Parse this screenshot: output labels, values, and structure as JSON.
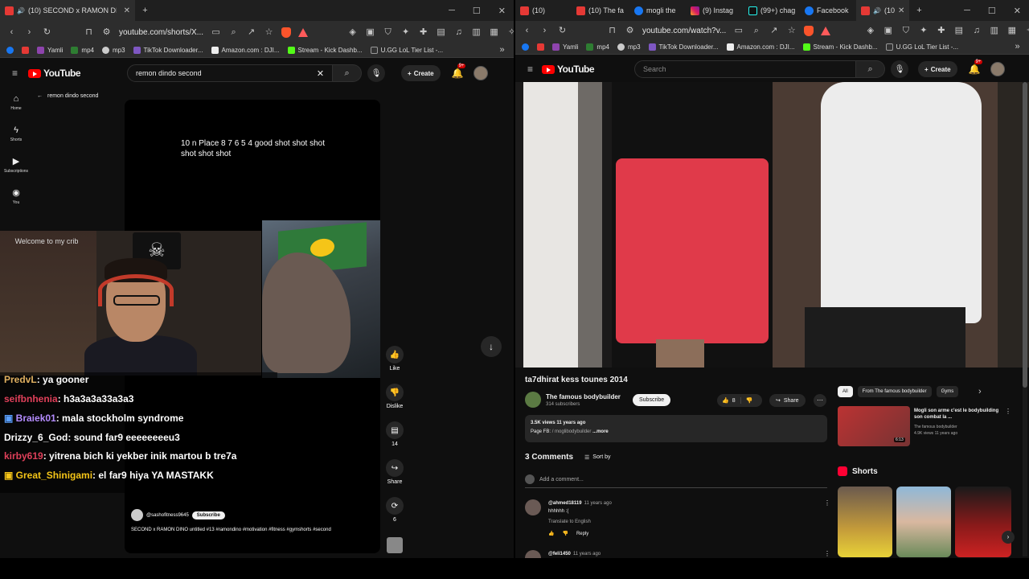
{
  "left": {
    "tab": {
      "title": "(10) SECOND x RAMON DINO"
    },
    "address": {
      "url": "youtube.com/shorts/X..."
    },
    "bookmarks": [
      "Yamli",
      "mp4",
      "mp3",
      "TikTok Downloader...",
      "Amazon.com : DJI...",
      "Stream - Kick Dashb...",
      "U.GG LoL Tier List -..."
    ],
    "header": {
      "search_value": "remon dindo second",
      "create_label": "Create",
      "bell_badge": "9+"
    },
    "nav": [
      {
        "label": "Home",
        "icon": "home-icon"
      },
      {
        "label": "Shorts",
        "icon": "shorts-icon"
      },
      {
        "label": "Subscriptions",
        "icon": "subscriptions-icon"
      },
      {
        "label": "You",
        "icon": "you-icon"
      }
    ],
    "back_label": "remon dindo second",
    "overlay_text": "10 n Place 8 7 6 5 4 good shot shot shot shot shot shot",
    "welcome_text": "Welcome to my crib",
    "chat": [
      {
        "user": "PredvL",
        "msg": ": ya gooner",
        "color": "#e0b060"
      },
      {
        "user": "seifbnhenia",
        "msg": ": h3a3a3a33a3a3",
        "color": "#e0405a"
      },
      {
        "user": "Braiek01",
        "msg": ": mala stockholm syndrome",
        "color": "#b48cff"
      },
      {
        "user": "Drizzy_6_God",
        "msg": ": sound far9 eeeeeeeeu3",
        "color": "#ffffff"
      },
      {
        "user": "kirby619",
        "msg": ": yitrena bich ki yekber inik martou b tre7a",
        "color": "#e0405a"
      },
      {
        "user": "Great_Shinigami",
        "msg": ": el far9 hiya YA MASTAKK",
        "color": "#f5c518"
      }
    ],
    "reel": {
      "channel": "@sashofitness9645",
      "subscribe": "Subscribe",
      "description": "SECOND x RAMON DINO untitled #13 #ramondino #motivation #fitness #gymshorts #second"
    },
    "actions": {
      "like": "Like",
      "dislike": "Dislike",
      "comments": "14",
      "share": "Share",
      "remix": "6"
    }
  },
  "right": {
    "tabs": [
      "(10)",
      "(10) The fa",
      "mogli the",
      "(9) Instag",
      "(99+) chag",
      "Facebook",
      "(10"
    ],
    "address": {
      "url": "youtube.com/watch?v..."
    },
    "bookmarks": [
      "Yamli",
      "mp4",
      "mp3",
      "TikTok Downloader...",
      "Amazon.com : DJI...",
      "Stream - Kick Dashb...",
      "U.GG LoL Tier List -..."
    ],
    "header": {
      "search_placeholder": "Search",
      "create_label": "Create",
      "bell_badge": "9+"
    },
    "video": {
      "title": "ta7dhirat kess tounes 2014",
      "channel": "The famous bodybuilder",
      "subscribers": "314 subscribers",
      "subscribe": "Subscribe",
      "likes": "8",
      "share": "Share",
      "views_line": "3.5K views  11 years ago",
      "desc_line": "Page FB:",
      "desc_link": "/ moglibodybuilder",
      "more": "...more"
    },
    "comments": {
      "count": "3 Comments",
      "sort": "Sort by",
      "add_placeholder": "Add a comment...",
      "items": [
        {
          "author": "@ahmed18119",
          "time": "11 years ago",
          "text": "hhhhhh :(",
          "translate": "Translate to English",
          "reply": "Reply"
        },
        {
          "author": "@feli1450",
          "time": "11 years ago"
        }
      ]
    },
    "chips": [
      "All",
      "From The famous bodybuilder",
      "Gyms"
    ],
    "recommended": {
      "title": "Mogli son arme c'est le bodybuilding son combat la ...",
      "channel": "The famous bodybuilder",
      "meta": "4.9K views  11 years ago",
      "duration": "6:13"
    },
    "shorts_heading": "Shorts"
  }
}
